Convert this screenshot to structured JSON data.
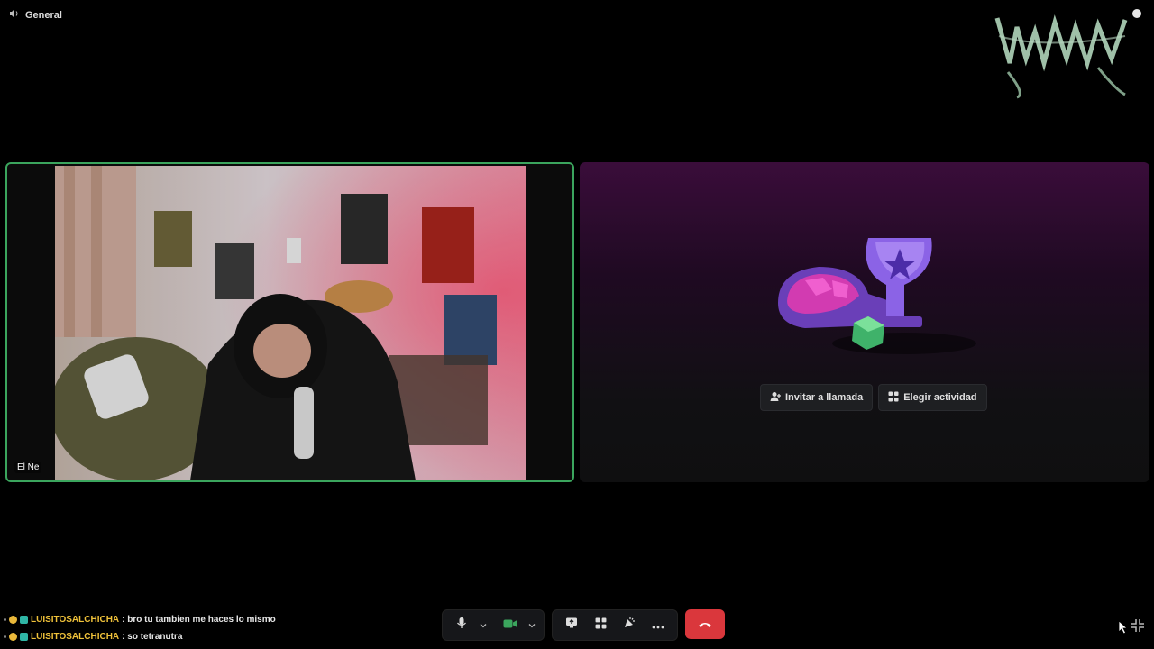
{
  "header": {
    "channel_name": "General",
    "channel_icon": "speaker-icon"
  },
  "participant": {
    "name": "El Ñe"
  },
  "empty_tile": {
    "invite_label": "Invitar a llamada",
    "invite_icon": "add-person-icon",
    "activity_label": "Elegir actividad",
    "activity_icon": "grid-apps-icon"
  },
  "chat": [
    {
      "user": "LUISITOSALCHICHA",
      "message": ": bro tu tambien me haces lo mismo"
    },
    {
      "user": "LUISITOSALCHICHA",
      "message": ": so tetranutra"
    }
  ],
  "controls": {
    "mic_icon": "microphone-icon",
    "camera_icon": "camera-icon",
    "screenshare_icon": "screen-share-icon",
    "activities_icon": "grid-apps-icon",
    "soundboard_icon": "soundboard-icon",
    "more_icon": "more-icon",
    "hangup_icon": "phone-hangup-icon",
    "hangup_color": "#da373c",
    "camera_on_color": "#3ba55d"
  },
  "colors": {
    "speaking_border": "#3ba55d",
    "username": "#f0c23a"
  }
}
